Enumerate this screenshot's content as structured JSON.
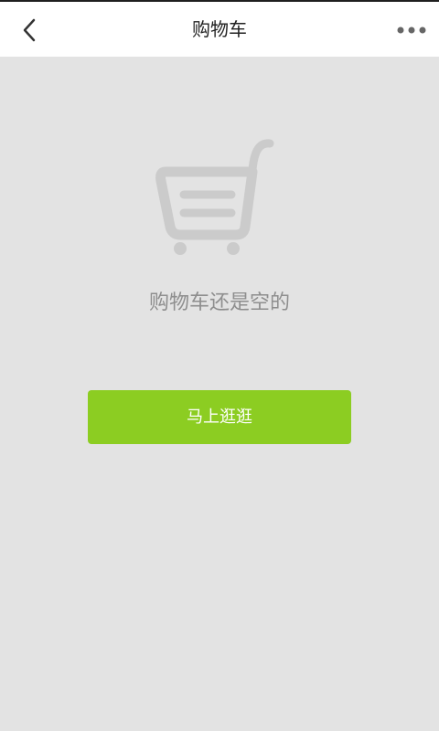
{
  "header": {
    "title": "购物车",
    "back_icon": "chevron-left-icon",
    "more_icon": "more-horizontal-icon"
  },
  "empty_state": {
    "icon": "shopping-cart-icon",
    "message": "购物车还是空的",
    "action_label": "马上逛逛"
  },
  "colors": {
    "background": "#e3e3e3",
    "header": "#ffffff",
    "accent": "#8ccd22",
    "icon_gray": "#cccccc",
    "text_gray": "#8e8e8e"
  }
}
